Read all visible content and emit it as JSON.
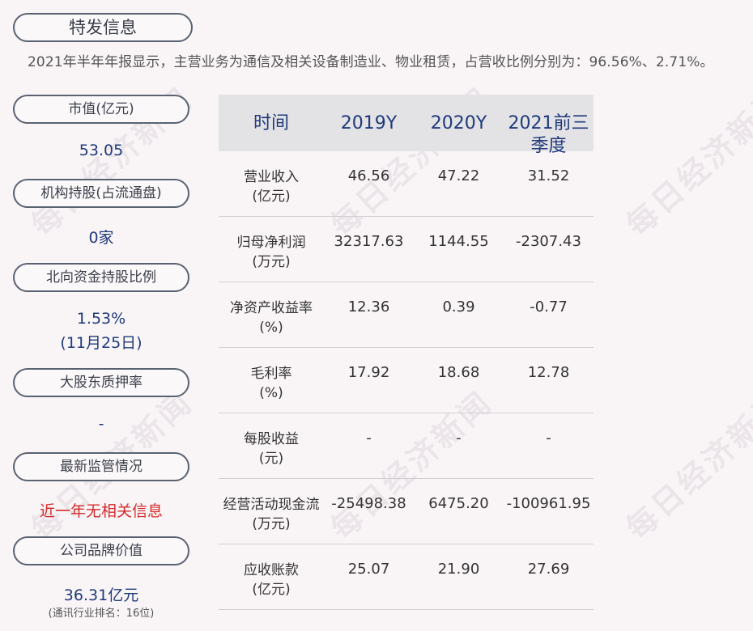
{
  "header": {
    "title": "特发信息",
    "intro": "2021年半年年报显示，主营业务为通信及相关设备制造业、物业租赁，占营收比例分别为：96.56%、2.71%。"
  },
  "left_panel": [
    {
      "label": "市值(亿元)",
      "value": "53.05"
    },
    {
      "label": "机构持股(占流通盘)",
      "value": "0家"
    },
    {
      "label": "北向资金持股比例",
      "value": "1.53%",
      "value2": "(11月25日)"
    },
    {
      "label": "大股东质押率",
      "value": "-"
    },
    {
      "label": "最新监管情况",
      "value": "近一年无相关信息"
    },
    {
      "label": "公司品牌价值",
      "value": "36.31亿元",
      "note": "(通讯行业排名：16位)"
    }
  ],
  "table": {
    "headers": [
      "时间",
      "2019Y",
      "2020Y",
      "2021前三",
      "季度"
    ],
    "rows": [
      {
        "label1": "营业收入",
        "label2": "(亿元)",
        "values": [
          "46.56",
          "47.22",
          "31.52"
        ]
      },
      {
        "label1": "归母净利润",
        "label2": "(万元)",
        "values": [
          "32317.63",
          "1144.55",
          "-2307.43"
        ]
      },
      {
        "label1": "净资产收益率",
        "label2": "(%)",
        "values": [
          "12.36",
          "0.39",
          "-0.77"
        ]
      },
      {
        "label1": "毛利率",
        "label2": "(%)",
        "values": [
          "17.92",
          "18.68",
          "12.78"
        ]
      },
      {
        "label1": "每股收益",
        "label2": "(元)",
        "values": [
          "-",
          "-",
          "-"
        ]
      },
      {
        "label1": "经营活动现金流",
        "label2": "(万元)",
        "values": [
          "-25498.38",
          "6475.20",
          "-100961.95"
        ]
      },
      {
        "label1": "应收账款",
        "label2": "(亿元)",
        "values": [
          "25.07",
          "21.90",
          "27.69"
        ]
      }
    ]
  },
  "watermark": "每日经济新闻",
  "colors": {
    "value_blue": "#1f3a7a",
    "alert_red": "#d42b2b",
    "header_bg": "#e3e2e5"
  }
}
